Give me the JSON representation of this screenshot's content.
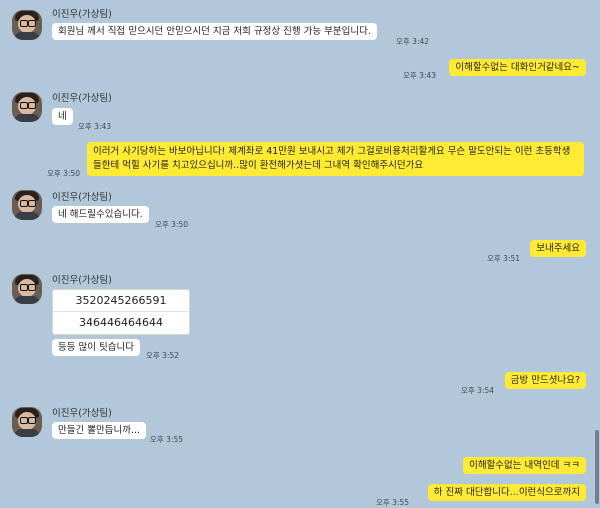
{
  "sender_name": "이진우(가상팀)",
  "messages": {
    "m1": {
      "text": "회원님 께서 직접 믿으시던 안믿으시던 지금 저희 규정상 진행 가능 부분입니다.",
      "time": "오후 3:42"
    },
    "m2": {
      "text": "이해할수없는 대화인거같네요~",
      "time": "오후 3:43"
    },
    "m3": {
      "text": "네",
      "time": "오후 3:43"
    },
    "m4": {
      "text": "이러거 사기당하는 바보아닙니다! 제계좌로 41만원 보내시고 제가 그걸로비용처리할게요 무슨 말도안되는 이런 초등학생들한테 먹힐 사기를 치고있으십니까..많이 환전해가셧는데 그내역 확인해주시던가요",
      "time": "오후 3:50"
    },
    "m5": {
      "text": "네 해드릴수있습니다.",
      "time": "오후 3:50"
    },
    "m6": {
      "text": "보내주세요",
      "time": "오후 3:51"
    },
    "m7_numbers": [
      "3520245266591",
      "346446464644"
    ],
    "m8": {
      "text": "등등 많이 팃습니다",
      "time": "오후 3:52"
    },
    "m9": {
      "text": "금방 만드셧나요?",
      "time": "오후 3:54"
    },
    "m10": {
      "text": "만들긴 뽈만듭니까...",
      "time": "오후 3:55"
    },
    "m11": {
      "text": "이해할수없는 내역인데 ㅋㅋ"
    },
    "m12": {
      "text": "하 진짜 대단합니다...이런식으로까지",
      "time": "오후 3:55"
    }
  },
  "colors": {
    "background": "#b2c7d9",
    "my_bubble": "#ffeb33",
    "their_bubble": "#ffffff"
  }
}
